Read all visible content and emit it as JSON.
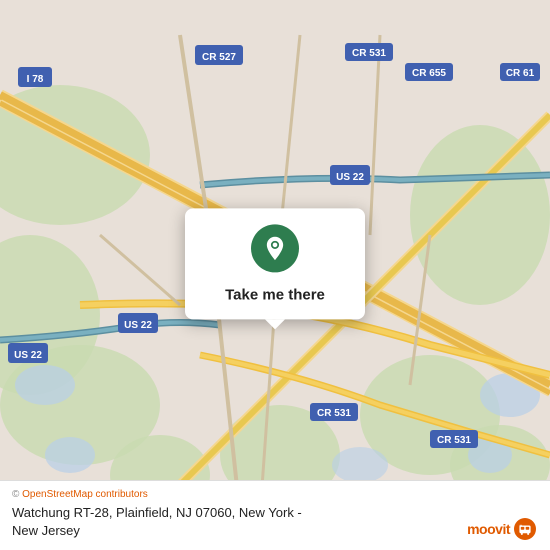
{
  "map": {
    "background_color": "#e8e0d8"
  },
  "popup": {
    "button_label": "Take me there",
    "icon": "location-pin-icon"
  },
  "bottom_bar": {
    "copyright_text": "© OpenStreetMap contributors",
    "address_line1": "Watchung RT-28, Plainfield, NJ 07060, New York -",
    "address_line2": "New Jersey"
  },
  "moovit": {
    "logo_text": "moovit"
  }
}
